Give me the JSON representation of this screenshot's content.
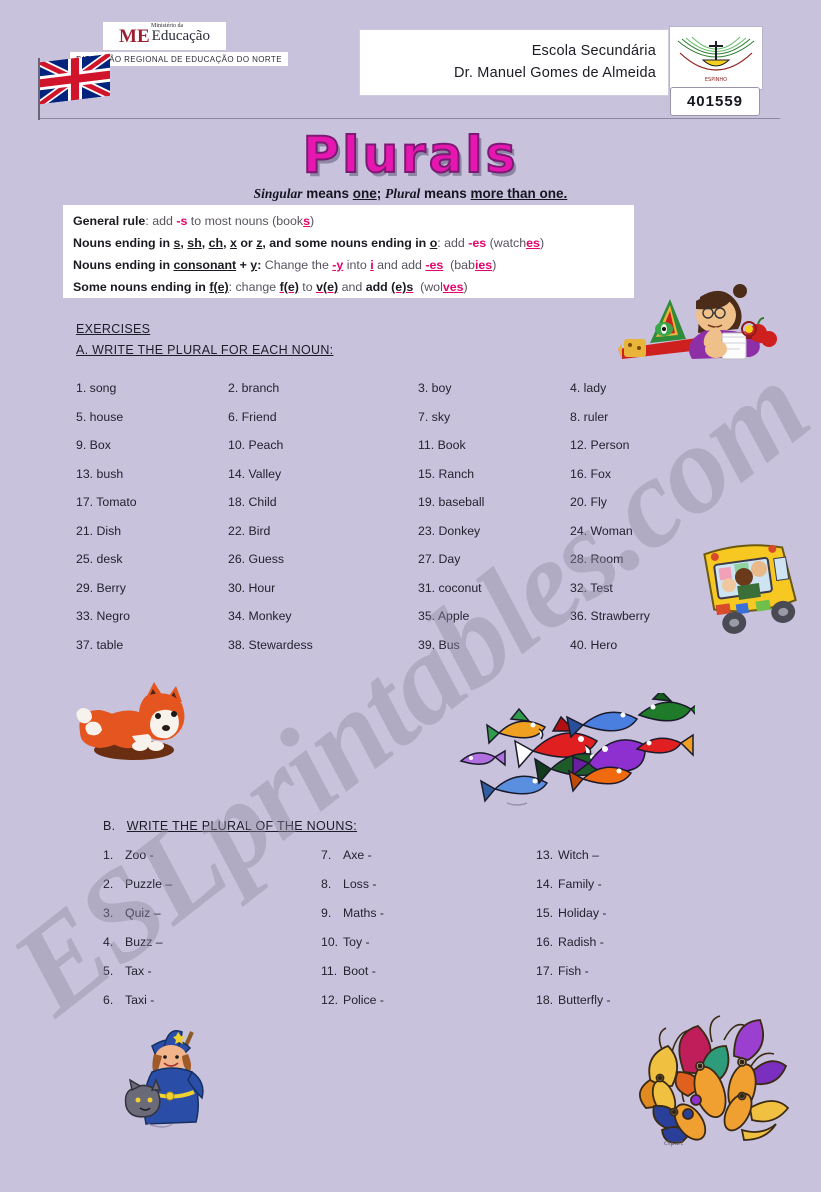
{
  "header": {
    "ministry_logo_mark": "ME",
    "ministry_logo_small": "Ministério da",
    "ministry_logo_word": "Educação",
    "ministry_subtitle": "DIRECÇÃO REGIONAL DE EDUCAÇÃO DO NORTE",
    "school_line1": "Escola Secundária",
    "school_line2": "Dr. Manuel Gomes de Almeida",
    "school_code": "401559",
    "flag_icon": "union-jack-flag-icon",
    "school_logo_icon": "school-crest-icon"
  },
  "title": "Plurals",
  "subtitle": {
    "word1": "Singular",
    "text1": " means ",
    "underline1": "one",
    "text2": "; ",
    "word2": "Plural",
    "text3": " means ",
    "underline2": "more than one."
  },
  "rules": [
    {
      "id": "general-rule",
      "segments": [
        {
          "t": "General rule",
          "s": "bold"
        },
        {
          "t": ": add ",
          "s": "plain"
        },
        {
          "t": "-s",
          "s": "magenta"
        },
        {
          "t": " to most nouns (book",
          "s": "plain"
        },
        {
          "t": "s",
          "s": "magenta-underline"
        },
        {
          "t": ")",
          "s": "plain"
        }
      ],
      "plain_text": "General rule: add -s to most nouns (books)"
    },
    {
      "id": "s-sh-ch-x-z-rule",
      "plain_text": "Nouns ending in s, sh, ch, x or z, and some nouns ending in o: add -es (watches)"
    },
    {
      "id": "consonant-y-rule",
      "plain_text": "Nouns ending in consonant + y: Change the -y into i and add -es  (babies)"
    },
    {
      "id": "f-fe-rule",
      "plain_text": "Some nouns ending in f(e): change f(e) to v(e) and add (e)s  (wolves)"
    }
  ],
  "exercises_label": "EXERCISES",
  "exercise_a": {
    "heading": "A. WRITE THE PLURAL FOR EACH NOUN:",
    "items": [
      "1. song",
      "2. branch",
      "3. boy",
      "4. lady",
      "5. house",
      "6. Friend",
      "7. sky",
      "8. ruler",
      "9. Box",
      "10. Peach",
      "11. Book",
      "12. Person",
      "13. bush",
      "14. Valley",
      "15. Ranch",
      "16. Fox",
      "17. Tomato",
      "18. Child",
      "19. baseball",
      "20. Fly",
      "21. Dish",
      "22. Bird",
      "23. Donkey",
      "24. Woman",
      "25. desk",
      "26. Guess",
      "27. Day",
      "28. Room",
      "29. Berry",
      "30. Hour",
      "31. coconut",
      "32. Test",
      "33. Negro",
      "34. Monkey",
      "35. Apple",
      "36. Strawberry",
      "37. table",
      "38. Stewardess",
      "39. Bus",
      "40. Hero"
    ]
  },
  "exercise_b": {
    "heading_prefix": "B.",
    "heading": "WRITE THE PLURAL OF THE NOUNS:",
    "items": [
      {
        "num": "1.",
        "text": "Zoo -"
      },
      {
        "num": "7.",
        "text": "Axe -"
      },
      {
        "num": "13.",
        "text": "Witch –"
      },
      {
        "num": "2.",
        "text": "Puzzle –"
      },
      {
        "num": "8.",
        "text": "Loss -"
      },
      {
        "num": "14.",
        "text": "Family -"
      },
      {
        "num": "3.",
        "text": "Quiz –"
      },
      {
        "num": "9.",
        "text": "Maths -"
      },
      {
        "num": "15.",
        "text": "Holiday -"
      },
      {
        "num": "4.",
        "text": "Buzz –"
      },
      {
        "num": "10.",
        "text": "Toy -"
      },
      {
        "num": "16.",
        "text": "Radish -"
      },
      {
        "num": "5.",
        "text": "Tax -"
      },
      {
        "num": "11.",
        "text": "Boot -"
      },
      {
        "num": "17.",
        "text": "Fish -"
      },
      {
        "num": "6.",
        "text": "Taxi -"
      },
      {
        "num": "12.",
        "text": "Police -"
      },
      {
        "num": "18.",
        "text": "Butterfly -"
      }
    ]
  },
  "watermark": "ESLprintables.com",
  "clipart": [
    {
      "id": "teacher-at-desk-image",
      "label": "teacher reading with apples and clock"
    },
    {
      "id": "school-bus-image",
      "label": "yellow school bus with children"
    },
    {
      "id": "fox-image",
      "label": "red fox sitting"
    },
    {
      "id": "fish-school-image",
      "label": "school of colourful fish"
    },
    {
      "id": "witch-image",
      "label": "witch with broom and cat"
    },
    {
      "id": "butterflies-image",
      "label": "group of colourful butterflies"
    }
  ],
  "colors": {
    "page_background": "#c9c2dd",
    "title_fill": "#e617b0",
    "title_stroke": "#7b1a72",
    "accent_magenta": "#e3036b",
    "text": "#23232e",
    "box_white": "#ffffff"
  }
}
